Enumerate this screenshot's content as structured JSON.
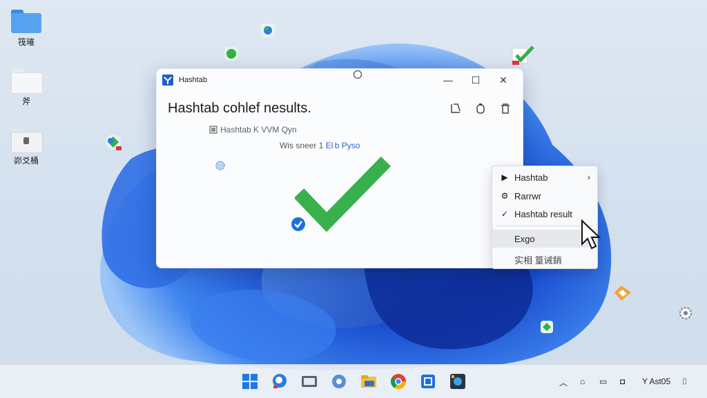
{
  "desktop": {
    "icons": [
      {
        "label": "筏璀"
      },
      {
        "label": "斧"
      },
      {
        "label": "峁爻桶"
      }
    ]
  },
  "window": {
    "title": "Hashtab",
    "minimize": "—",
    "maximize": "☐",
    "close": "✕",
    "heading": "Hashtab cohlef nesults.",
    "subline": "Hashtab K VVM Qyn",
    "subline2_prefix": "Wis sneer 1",
    "subline2_link": "El b Pyso"
  },
  "context_menu": {
    "items": [
      {
        "label": "Hashtab",
        "icon": "hashtab-icon",
        "has_submenu": true
      },
      {
        "label": "Rarrwr",
        "icon": "gear-icon",
        "has_submenu": false
      },
      {
        "label": "Hashtab result",
        "icon": "check-icon",
        "has_submenu": false
      },
      {
        "label": "Exgo",
        "icon": "",
        "has_submenu": false
      },
      {
        "label": "实相 篁诫銷",
        "icon": "",
        "has_submenu": false
      }
    ]
  },
  "taskbar": {
    "tray_text": "Y Ast05"
  },
  "colors": {
    "accent": "#1f6fe0",
    "success": "#2fb24a",
    "folder": "#4a9be8"
  }
}
